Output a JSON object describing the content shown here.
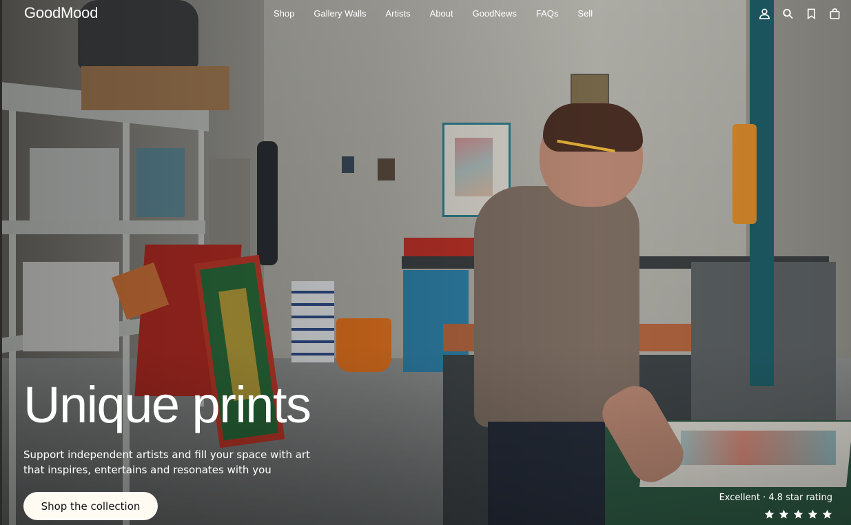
{
  "header": {
    "logo": "GoodMood",
    "nav": [
      "Shop",
      "Gallery Walls",
      "Artists",
      "About",
      "GoodNews",
      "FAQs",
      "Sell"
    ],
    "icons": [
      "account-icon",
      "search-icon",
      "bookmark-icon",
      "shopping-bag-icon"
    ]
  },
  "hero": {
    "headline": "Unique prints",
    "subtext": "Support independent artists and fill your space with art that inspires, entertains and resonates with you",
    "cta_label": "Shop the collection",
    "rating_text": "Excellent · 4.8 star rating",
    "stars": 5
  },
  "colors": {
    "cta_background": "#fffaf2",
    "text": "#ffffff"
  }
}
